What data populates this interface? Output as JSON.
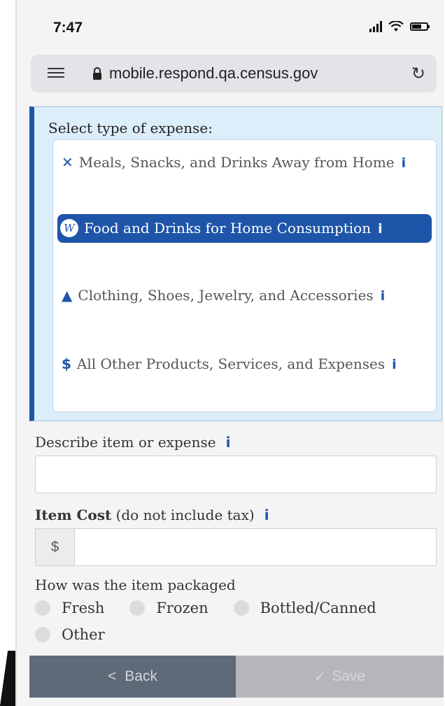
{
  "status_bar": {
    "time": "7:47"
  },
  "url_bar": {
    "url": "mobile.respond.qa.census.gov"
  },
  "expense_type": {
    "title": "Select type of expense:",
    "options": [
      {
        "icon": "utensils-icon",
        "label": "Meals, Snacks, and Drinks Away from Home",
        "selected": false
      },
      {
        "icon": "w-badge-icon",
        "label": "Food and Drinks for Home Consumption",
        "selected": true
      },
      {
        "icon": "shirt-icon",
        "label": "Clothing, Shoes, Jewelry, and Accessories",
        "selected": false
      },
      {
        "icon": "dollar-icon",
        "label": "All Other Products, Services, and Expenses",
        "selected": false
      }
    ],
    "w_badge_text": "W",
    "dollar_glyph": "$"
  },
  "form": {
    "describe_label": "Describe item or expense",
    "describe_value": "",
    "cost_label": "Item Cost",
    "cost_hint": "(do not include tax)",
    "cost_prefix": "$",
    "cost_value": "",
    "packaging_label": "How was the item packaged",
    "packaging_options": [
      "Fresh",
      "Frozen",
      "Bottled/Canned",
      "Other"
    ]
  },
  "footer": {
    "back_label": "Back",
    "save_label": "Save"
  },
  "colors": {
    "accent": "#1f55a8",
    "panel_bg": "#dceefa",
    "back_bg": "#5f6a78",
    "save_bg": "#b4b6ba"
  }
}
